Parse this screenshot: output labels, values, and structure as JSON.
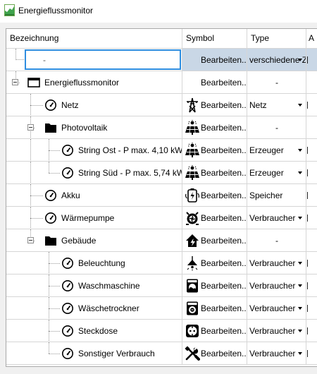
{
  "window": {
    "title": "Energieflussmonitor"
  },
  "columns": [
    "Bezeichnung",
    "Symbol",
    "Type",
    "A"
  ],
  "rows": [
    {
      "name": "-",
      "symbol": "Bearbeiten...",
      "symbol_icon": "none",
      "type": "verschiedene Z",
      "type_dropdown": true,
      "selected": true
    },
    {
      "name": "Energieflussmonitor",
      "symbol": "Bearbeiten...",
      "symbol_icon": "none",
      "type": "-",
      "type_dropdown": false
    },
    {
      "name": "Netz",
      "symbol": "Bearbeiten...",
      "symbol_icon": "power-tower-icon",
      "type": "Netz",
      "type_dropdown": true
    },
    {
      "name": "Photovoltaik",
      "symbol": "Bearbeiten...",
      "symbol_icon": "solar-panel-icon",
      "type": "-",
      "type_dropdown": false
    },
    {
      "name": "String Ost - P max. 4,10 kW",
      "symbol": "Bearbeiten...",
      "symbol_icon": "solar-panel-icon",
      "type": "Erzeuger",
      "type_dropdown": true
    },
    {
      "name": "String Süd - P max. 5,74 kW",
      "symbol": "Bearbeiten...",
      "symbol_icon": "solar-panel-icon",
      "type": "Erzeuger",
      "type_dropdown": true
    },
    {
      "name": "Akku",
      "symbol": "Bearbeiten...",
      "symbol_icon": "battery-icon",
      "type": "Speicher",
      "type_dropdown": false
    },
    {
      "name": "Wärmepumpe",
      "symbol": "Bearbeiten...",
      "symbol_icon": "heat-pump-icon",
      "type": "Verbraucher",
      "type_dropdown": true
    },
    {
      "name": "Gebäude",
      "symbol": "Bearbeiten...",
      "symbol_icon": "house-lightning-icon",
      "type": "-",
      "type_dropdown": false
    },
    {
      "name": "Beleuchtung",
      "symbol": "Bearbeiten...",
      "symbol_icon": "ceiling-lamp-icon",
      "type": "Verbraucher",
      "type_dropdown": true
    },
    {
      "name": "Waschmaschine",
      "symbol": "Bearbeiten...",
      "symbol_icon": "washing-machine-icon",
      "type": "Verbraucher",
      "type_dropdown": true
    },
    {
      "name": "Wäschetrockner",
      "symbol": "Bearbeiten...",
      "symbol_icon": "dryer-icon",
      "type": "Verbraucher",
      "type_dropdown": true
    },
    {
      "name": "Steckdose",
      "symbol": "Bearbeiten...",
      "symbol_icon": "power-socket-icon",
      "type": "Verbraucher",
      "type_dropdown": true
    },
    {
      "name": "Sonstiger Verbrauch",
      "symbol": "Bearbeiten...",
      "symbol_icon": "tools-icon",
      "type": "Verbraucher",
      "type_dropdown": true
    }
  ],
  "node_icons": {
    "root": "window-icon",
    "folder": "folder-icon",
    "meter": "gauge-icon"
  },
  "colors": {
    "selection_border": "#2f8ee0",
    "selection_fill": "#c9d7e6",
    "app_icon_green": "#3fa34d"
  }
}
